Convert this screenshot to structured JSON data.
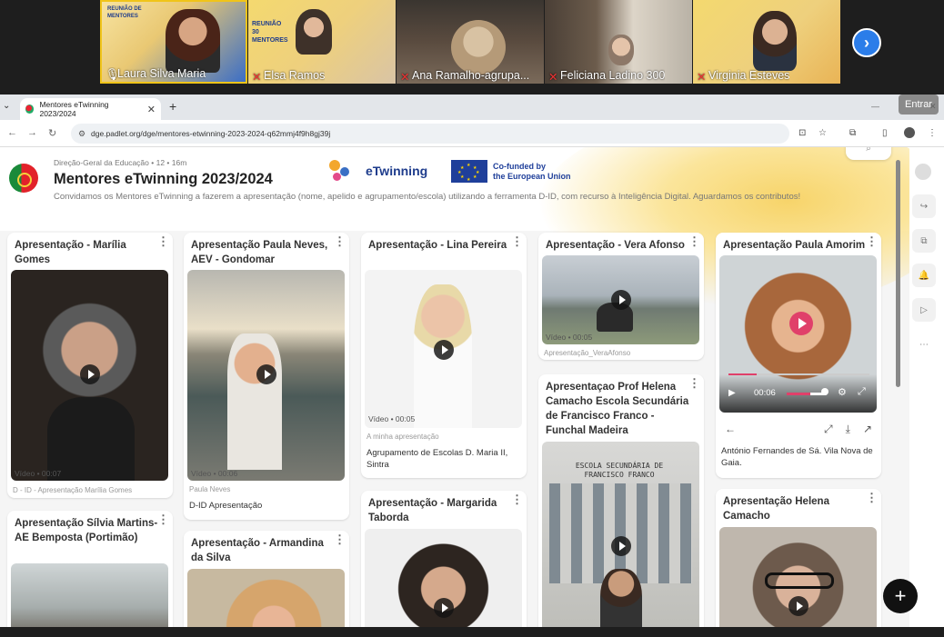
{
  "call": {
    "participants": [
      {
        "name": "Laura Silva Maria",
        "active": true
      },
      {
        "name": "Elsa Ramos"
      },
      {
        "name": "Ana Ramalho-agrupa..."
      },
      {
        "name": "Feliciana Ladino 300"
      },
      {
        "name": "Virginia Esteves"
      }
    ],
    "slide_title": "REUNIÃO DE MENTORES",
    "slide_title_right": "REUNIÃO 30 MENTORES",
    "next_icon": "chevron-right-icon",
    "enter_label": "Entrar"
  },
  "browser": {
    "tab_title": "Mentores eTwinning 2023/2024",
    "url": "dge.padlet.org/dge/mentores-etwinning-2023-2024-q62mmj4f9h8gj39j"
  },
  "padlet": {
    "meta": "Direção-Geral da Educação • 12 • 16m",
    "title": "Mentores eTwinning 2023/2024",
    "description": "Convidamos os Mentores eTwinning a fazerem a apresentação (nome, apelido e agrupamento/escola) utilizando a ferramenta D-ID, com recurso à Inteligência Digital.  Aguardamos os contributos!",
    "etwinning_label": "eTwinning",
    "eu_label_1": "Co-funded by",
    "eu_label_2": "the European Union",
    "search_icon": "search-icon"
  },
  "posts": {
    "c1p1": {
      "title": "Apresentação - Marília Gomes",
      "video": "Vídeo",
      "dur": "00:07",
      "caption": "D - ID - Apresentação Marília Gomes"
    },
    "c1p2": {
      "title": "Apresentação Sílvia Martins- AE Bemposta (Portimão)"
    },
    "c2p1": {
      "title": "Apresentação Paula Neves, AEV - Gondomar",
      "video": "Vídeo",
      "dur": "00:06",
      "caption": "Paula Neves",
      "body": "D-ID Apresentação"
    },
    "c2p2": {
      "title": "Apresentação - Armandina da Silva"
    },
    "c3p1": {
      "title": "Apresentação - Lina Pereira",
      "video": "Vídeo",
      "dur": "00:05",
      "caption": "A minha apresentação",
      "body": "Agrupamento de Escolas D. Maria II, Sintra"
    },
    "c3p2": {
      "title": "Apresentação - Margarida Taborda"
    },
    "c4p1": {
      "title": "Apresentação - Vera Afonso",
      "video": "Vídeo",
      "dur": "00:05",
      "caption": "Apresentação_VeraAfonso"
    },
    "c4p2": {
      "title": "Apresentaçao Prof Helena Camacho  Escola Secundária de Francisco Franco - Funchal Madeira",
      "sign": "ESCOLA SECUNDÁRIA DE FRANCISCO FRANCO"
    },
    "c5p1": {
      "title": "Apresentação Paula Amorim",
      "time": "00:06",
      "body": "António Fernandes de Sá. Vila Nova de Gaia."
    },
    "c5p2": {
      "title": "Apresentação Helena Camacho"
    }
  },
  "fab_label": "+"
}
